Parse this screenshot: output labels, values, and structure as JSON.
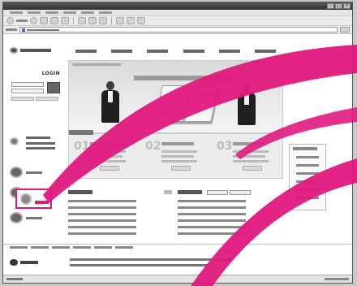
{
  "browser": {
    "title": "",
    "menu": [
      "",
      "",
      "",
      "",
      "",
      ""
    ],
    "address": "",
    "status": ""
  },
  "site": {
    "logo_text": "",
    "gnb": [
      "",
      "",
      "",
      "",
      "",
      ""
    ]
  },
  "login": {
    "title": "LOGIN",
    "button": "",
    "links": [
      "",
      ""
    ]
  },
  "support": {
    "title": "",
    "phone": "",
    "fax": ""
  },
  "sidebar": {
    "items": [
      {
        "label": "",
        "icon": "consult-icon"
      },
      {
        "label": "",
        "icon": "training-icon"
      },
      {
        "label": "",
        "icon": "cafe-icon",
        "highlighted": true
      }
    ],
    "highlight_color": "#e0197d"
  },
  "banner": {
    "caption": "",
    "headline": ""
  },
  "programs": {
    "heading": "",
    "items": [
      {
        "num": "01",
        "title": "",
        "button": ""
      },
      {
        "num": "02",
        "title": "",
        "button": ""
      },
      {
        "num": "03",
        "title": "",
        "button": ""
      }
    ]
  },
  "quick_menu": {
    "title": "",
    "items": [
      "",
      "",
      "",
      "",
      "",
      ""
    ]
  },
  "boards": {
    "notice": {
      "title": "",
      "more": "",
      "rows": [
        {
          "title": "",
          "date": ""
        },
        {
          "title": "",
          "date": ""
        },
        {
          "title": "",
          "date": ""
        },
        {
          "title": "",
          "date": ""
        },
        {
          "title": "",
          "date": ""
        },
        {
          "title": "",
          "date": ""
        }
      ]
    },
    "news": {
      "title": "",
      "tabs": [
        "",
        ""
      ],
      "rows": [
        {
          "title": "",
          "date": ""
        },
        {
          "title": "",
          "date": ""
        },
        {
          "title": "",
          "date": ""
        },
        {
          "title": "",
          "date": ""
        },
        {
          "title": "",
          "date": ""
        },
        {
          "title": "",
          "date": ""
        }
      ]
    }
  },
  "footer": {
    "links": [
      "",
      "",
      "",
      "",
      "",
      ""
    ],
    "logo_text": "",
    "address": "",
    "copyright": ""
  },
  "colors": {
    "callout": "#e0197d",
    "frame": "#c9c9c9"
  }
}
